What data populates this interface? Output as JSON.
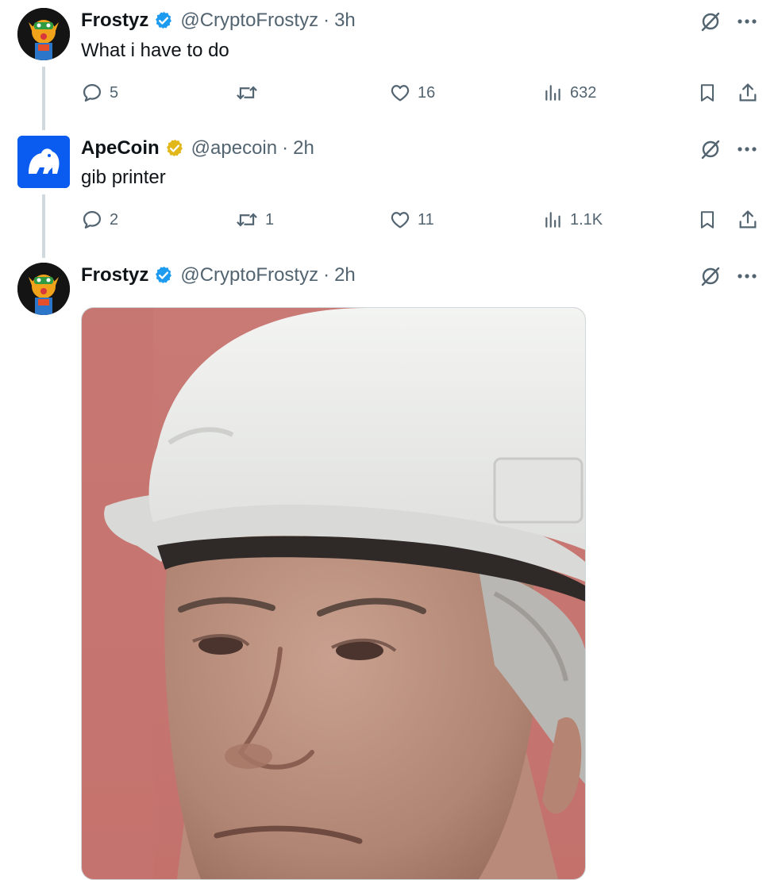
{
  "tweets": [
    {
      "name": "Frostyz",
      "handle": "@CryptoFrostyz",
      "dot": "·",
      "time": "3h",
      "text": "What i have to do",
      "replies": "5",
      "reposts": "",
      "likes": "16",
      "views": "632"
    },
    {
      "name": "ApeCoin",
      "handle": "@apecoin",
      "dot": "·",
      "time": "2h",
      "text": "gib printer",
      "replies": "2",
      "reposts": "1",
      "likes": "11",
      "views": "1.1K"
    },
    {
      "name": "Frostyz",
      "handle": "@CryptoFrostyz",
      "dot": "·",
      "time": "2h"
    }
  ],
  "colors": {
    "verified_blue": "#1d9bf0",
    "verified_gold": "#e2b719",
    "muted_text": "#536471",
    "apecoin_blue": "#0a5cf0"
  },
  "icons": {
    "reply": "reply-icon",
    "repost": "repost-icon",
    "like": "like-icon",
    "views": "views-icon",
    "bookmark": "bookmark-icon",
    "share": "share-icon",
    "grok": "grok-icon",
    "more": "more-icon"
  }
}
